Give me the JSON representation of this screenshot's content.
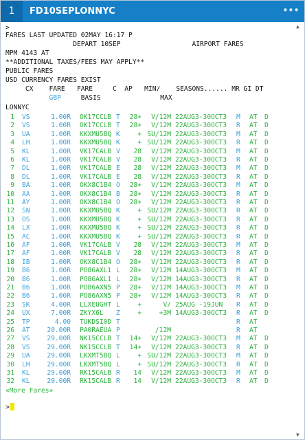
{
  "window": {
    "tab_number": "1",
    "title": "FD10SEPLONNYC",
    "menu_glyph": "•••"
  },
  "output": {
    "prompt": ">",
    "header_lines": [
      "FARES LAST UPDATED 02MAY 16:17 P",
      "                 DEPART 10SEP                  AIRPORT FARES",
      "MPM 4143 AT",
      "**ADDITIONAL TAXES/FEES MAY APPLY**",
      "PUBLIC FARES",
      "USD CURRENCY FARES EXIST"
    ],
    "col_header_1": "     CX    FARE   FARE     C  AP   MIN/    SEASONS...... MR GI DT",
    "col_header_2_pre": "           ",
    "col_header_2_gbp": "GBP",
    "col_header_2_post": "     BASIS               MAX",
    "city_pair": "LONNYC",
    "more_label": "«More Fares»",
    "input_prompt": ">",
    "fares": [
      {
        "n": "1",
        "cx": "VS",
        "fare": "1.00R",
        "basis": "OK17CCLB",
        "c": "T",
        "ap": "28+",
        "min": "V/12M",
        "season": "22AUG3-30OCT3",
        "mr": "M",
        "gi": "AT",
        "dt": "D"
      },
      {
        "n": "2",
        "cx": "VS",
        "fare": "1.00R",
        "basis": "OK17CCLB",
        "c": "T",
        "ap": "28+",
        "min": "V/12M",
        "season": "22AUG3-30OCT3",
        "mr": "R",
        "gi": "AT",
        "dt": "D"
      },
      {
        "n": "3",
        "cx": "UA",
        "fare": "1.00R",
        "basis": "KKXMU5BQ",
        "c": "K",
        "ap": "+",
        "min": "SU/12M",
        "season": "22AUG3-30OCT3",
        "mr": "M",
        "gi": "AT",
        "dt": "D"
      },
      {
        "n": "4",
        "cx": "LH",
        "fare": "1.00R",
        "basis": "KKXMU5BQ",
        "c": "K",
        "ap": "+",
        "min": "SU/12M",
        "season": "22AUG3-30OCT3",
        "mr": "R",
        "gi": "AT",
        "dt": "D"
      },
      {
        "n": "5",
        "cx": "KL",
        "fare": "1.00R",
        "basis": "VK17CALB",
        "c": "V",
        "ap": "28",
        "min": "V/12M",
        "season": "22AUG3-30OCT3",
        "mr": "M",
        "gi": "AT",
        "dt": "D"
      },
      {
        "n": "6",
        "cx": "KL",
        "fare": "1.00R",
        "basis": "VK17CALB",
        "c": "V",
        "ap": "28",
        "min": "V/12M",
        "season": "22AUG3-30OCT3",
        "mr": "R",
        "gi": "AT",
        "dt": "D"
      },
      {
        "n": "7",
        "cx": "DL",
        "fare": "1.00R",
        "basis": "VK17CALB",
        "c": "E",
        "ap": "28",
        "min": "V/12M",
        "season": "22AUG3-30OCT3",
        "mr": "M",
        "gi": "AT",
        "dt": "D"
      },
      {
        "n": "8",
        "cx": "DL",
        "fare": "1.00R",
        "basis": "VK17CALB",
        "c": "E",
        "ap": "28",
        "min": "V/12M",
        "season": "22AUG3-30OCT3",
        "mr": "R",
        "gi": "AT",
        "dt": "D"
      },
      {
        "n": "9",
        "cx": "BA",
        "fare": "1.00R",
        "basis": "OKX8C1B4",
        "c": "O",
        "ap": "28+",
        "min": "V/12M",
        "season": "22AUG3-30OCT3",
        "mr": "M",
        "gi": "AT",
        "dt": "D"
      },
      {
        "n": "10",
        "cx": "AA",
        "fare": "1.00R",
        "basis": "OKX8C1B4",
        "c": "B",
        "ap": "28+",
        "min": "V/12M",
        "season": "22AUG3-30OCT3",
        "mr": "R",
        "gi": "AT",
        "dt": "D"
      },
      {
        "n": "11",
        "cx": "AY",
        "fare": "1.00R",
        "basis": "OKX8C1B4",
        "c": "O",
        "ap": "28+",
        "min": "V/12M",
        "season": "22AUG3-30OCT3",
        "mr": "R",
        "gi": "AT",
        "dt": "D"
      },
      {
        "n": "12",
        "cx": "SN",
        "fare": "1.00R",
        "basis": "KKXMU5BQ",
        "c": "K",
        "ap": "+",
        "min": "SU/12M",
        "season": "22AUG3-30OCT3",
        "mr": "R",
        "gi": "AT",
        "dt": "D"
      },
      {
        "n": "13",
        "cx": "OS",
        "fare": "1.00R",
        "basis": "KKXMU5BQ",
        "c": "K",
        "ap": "+",
        "min": "SU/12M",
        "season": "22AUG3-30OCT3",
        "mr": "R",
        "gi": "AT",
        "dt": "D"
      },
      {
        "n": "14",
        "cx": "LX",
        "fare": "1.00R",
        "basis": "KKXMU5BQ",
        "c": "K",
        "ap": "+",
        "min": "SU/12M",
        "season": "22AUG3-30OCT3",
        "mr": "R",
        "gi": "AT",
        "dt": "D"
      },
      {
        "n": "15",
        "cx": "AC",
        "fare": "1.00R",
        "basis": "KKXMU5BQ",
        "c": "K",
        "ap": "+",
        "min": "SU/12M",
        "season": "22AUG3-30OCT3",
        "mr": "R",
        "gi": "AT",
        "dt": "D"
      },
      {
        "n": "16",
        "cx": "AF",
        "fare": "1.00R",
        "basis": "VK17CALB",
        "c": "V",
        "ap": "28",
        "min": "V/12M",
        "season": "22AUG3-30OCT3",
        "mr": "M",
        "gi": "AT",
        "dt": "D"
      },
      {
        "n": "17",
        "cx": "AF",
        "fare": "1.00R",
        "basis": "VK17CALB",
        "c": "V",
        "ap": "28",
        "min": "V/12M",
        "season": "22AUG3-30OCT3",
        "mr": "R",
        "gi": "AT",
        "dt": "D"
      },
      {
        "n": "18",
        "cx": "IB",
        "fare": "1.00R",
        "basis": "OKX8C1B4",
        "c": "O",
        "ap": "28+",
        "min": "V/12M",
        "season": "22AUG3-30OCT3",
        "mr": "R",
        "gi": "AT",
        "dt": "D"
      },
      {
        "n": "19",
        "cx": "B6",
        "fare": "1.00R",
        "basis": "PO86AXL1",
        "c": "L",
        "ap": "28+",
        "min": "V/12M",
        "season": "14AUG3-30OCT3",
        "mr": "M",
        "gi": "AT",
        "dt": "D"
      },
      {
        "n": "20",
        "cx": "B6",
        "fare": "1.00R",
        "basis": "PO86AXL1",
        "c": "L",
        "ap": "28+",
        "min": "V/12M",
        "season": "14AUG3-30OCT3",
        "mr": "R",
        "gi": "AT",
        "dt": "D"
      },
      {
        "n": "21",
        "cx": "B6",
        "fare": "1.00R",
        "basis": "PO86AXN5",
        "c": "P",
        "ap": "28+",
        "min": "V/12M",
        "season": "14AUG3-30OCT3",
        "mr": "M",
        "gi": "AT",
        "dt": "D"
      },
      {
        "n": "22",
        "cx": "B6",
        "fare": "1.00R",
        "basis": "PO86AXN5",
        "c": "P",
        "ap": "28+",
        "min": "V/12M",
        "season": "14AUG3-30OCT3",
        "mr": "R",
        "gi": "AT",
        "dt": "D"
      },
      {
        "n": "23",
        "cx": "SK",
        "fare": "4.00R",
        "basis": "LLXEUGHT",
        "c": "L",
        "ap": "+",
        "min": "V/",
        "season": "25AUG -19JUN",
        "mr": "R",
        "gi": "AT",
        "dt": "D"
      },
      {
        "n": "24",
        "cx": "UX",
        "fare": "7.00R",
        "basis": "ZKYX6L",
        "c": "Z",
        "ap": "+",
        "min": "+3M",
        "season": "14AUG3-30OCT3",
        "mr": "R",
        "gi": "AT",
        "dt": "D"
      },
      {
        "n": "25",
        "cx": "TP",
        "fare": "4.00",
        "basis": "TUKDSI0D",
        "c": "T",
        "ap": "",
        "min": "",
        "season": "",
        "mr": "R",
        "gi": "AT",
        "dt": ""
      },
      {
        "n": "26",
        "cx": "AT",
        "fare": "20.00R",
        "basis": "PA0RAEUA",
        "c": "P",
        "ap": "",
        "min": "/12M",
        "season": "",
        "mr": "R",
        "gi": "AT",
        "dt": ""
      },
      {
        "n": "27",
        "cx": "VS",
        "fare": "29.00R",
        "basis": "NK15CCLB",
        "c": "T",
        "ap": "14+",
        "min": "V/12M",
        "season": "22AUG3-30OCT3",
        "mr": "M",
        "gi": "AT",
        "dt": "D"
      },
      {
        "n": "28",
        "cx": "VS",
        "fare": "29.00R",
        "basis": "NK15CCLB",
        "c": "T",
        "ap": "14+",
        "min": "V/12M",
        "season": "22AUG3-30OCT3",
        "mr": "R",
        "gi": "AT",
        "dt": "D"
      },
      {
        "n": "29",
        "cx": "UA",
        "fare": "29.00R",
        "basis": "LKXMT5BQ",
        "c": "L",
        "ap": "+",
        "min": "SU/12M",
        "season": "22AUG3-30OCT3",
        "mr": "M",
        "gi": "AT",
        "dt": "D"
      },
      {
        "n": "30",
        "cx": "LH",
        "fare": "29.00R",
        "basis": "LKXMT5BQ",
        "c": "L",
        "ap": "+",
        "min": "SU/12M",
        "season": "22AUG3-30OCT3",
        "mr": "R",
        "gi": "AT",
        "dt": "D"
      },
      {
        "n": "31",
        "cx": "KL",
        "fare": "29.00R",
        "basis": "RK15CALB",
        "c": "R",
        "ap": "14",
        "min": "V/12M",
        "season": "22AUG3-30OCT3",
        "mr": "M",
        "gi": "AT",
        "dt": "D"
      },
      {
        "n": "32",
        "cx": "KL",
        "fare": "29.00R",
        "basis": "RK15CALB",
        "c": "R",
        "ap": "14",
        "min": "V/12M",
        "season": "22AUG3-30OCT3",
        "mr": "R",
        "gi": "AT",
        "dt": "D"
      }
    ]
  },
  "colors": {
    "titlebar": "#1580c8",
    "tab_badge": "#0e6aab",
    "fare_green": "#2db23d",
    "fare_blue": "#3aa0dc",
    "cursor": "#f2e600"
  }
}
